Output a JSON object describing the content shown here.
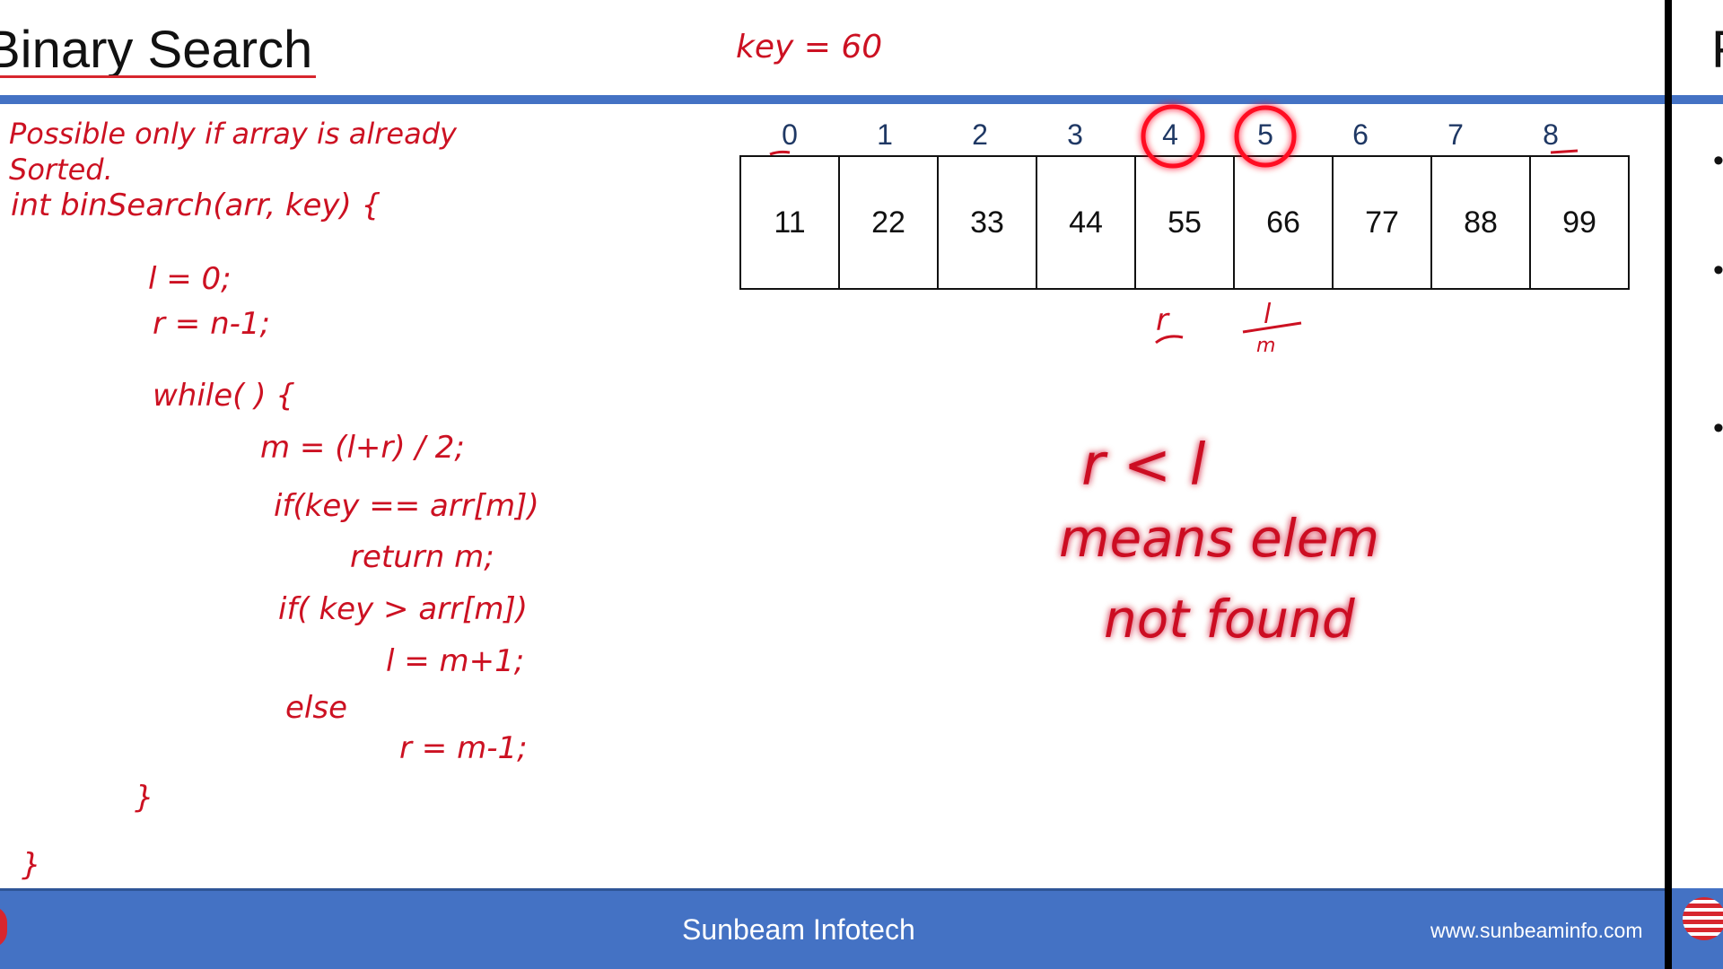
{
  "slide": {
    "title": "Binary Search",
    "footer_center": "Sunbeam Infotech",
    "footer_url": "www.sunbeaminfo.com"
  },
  "array": {
    "indices": [
      "0",
      "1",
      "2",
      "3",
      "4",
      "5",
      "6",
      "7",
      "8"
    ],
    "values": [
      "11",
      "22",
      "33",
      "44",
      "55",
      "66",
      "77",
      "88",
      "99"
    ]
  },
  "annotations": {
    "key": "key = 60",
    "note_line1": "Possible only if array is already",
    "note_line2": "Sorted.",
    "code": [
      "int   binSearch(arr, key) {",
      "l = 0;",
      "r = n-1;",
      "while(               ) {",
      "m = (l+r) / 2;",
      "if(key == arr[m])",
      "return m;",
      "if( key > arr[m])",
      "l = m+1;",
      "else",
      "r = m-1;",
      "}",
      "}"
    ],
    "under_r": "r",
    "under_l": "l",
    "under_m": "m",
    "condition": "r < l",
    "means1": "means elem",
    "means2": "not found"
  },
  "next_slide": {
    "title_fragment": "F",
    "bullets": [
      "•",
      "•",
      "•"
    ]
  }
}
